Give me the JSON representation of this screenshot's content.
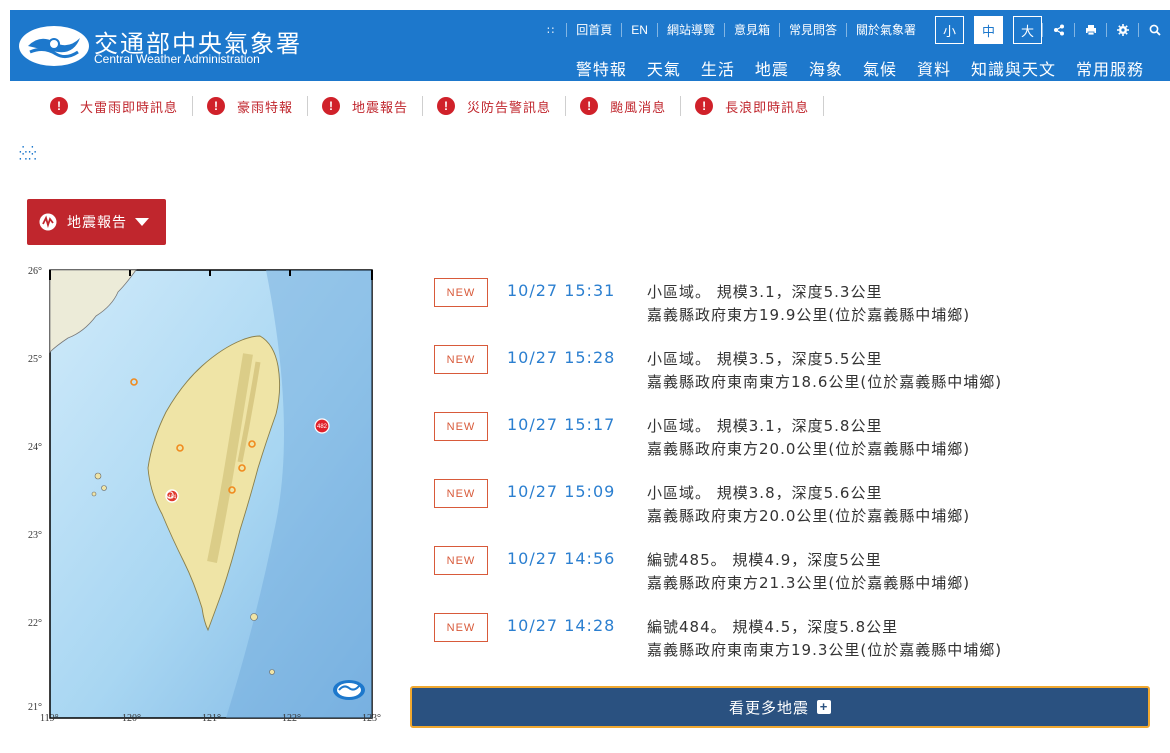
{
  "header": {
    "brand_zh": "交通部中央氣象署",
    "brand_en": "Central Weather Administration",
    "utility_links": [
      "回首頁",
      "EN",
      "網站導覽",
      "意見箱",
      "常見問答",
      "關於氣象署"
    ],
    "font_sizes": [
      "小",
      "中",
      "大"
    ],
    "active_font_size": "中",
    "tool_icons": [
      "share-icon",
      "print-icon",
      "gear-icon",
      "search-icon"
    ],
    "main_nav": [
      "警特報",
      "天氣",
      "生活",
      "地震",
      "海象",
      "氣候",
      "資料",
      "知識與天文",
      "常用服務"
    ]
  },
  "alerts": [
    {
      "label": "大雷雨即時訊息",
      "icon": "exclamation-icon"
    },
    {
      "label": "豪雨特報",
      "icon": "exclamation-icon"
    },
    {
      "label": "地震報告",
      "icon": "exclamation-icon"
    },
    {
      "label": "災防告警訊息",
      "icon": "exclamation-icon"
    },
    {
      "label": "颱風消息",
      "icon": "exclamation-icon"
    },
    {
      "label": "長浪即時訊息",
      "icon": "exclamation-icon"
    }
  ],
  "dropdown": {
    "label": "地震報告"
  },
  "map": {
    "lat_labels": [
      "26°",
      "25°",
      "24°",
      "23°",
      "22°",
      "21°"
    ],
    "lon_labels": [
      "119°",
      "120°",
      "121°",
      "122°",
      "123°"
    ],
    "marker_labels": [
      "484",
      "482"
    ]
  },
  "events": [
    {
      "badge": "NEW",
      "time": "10/27 15:31",
      "line1": "小區域。 規模3.1，深度5.3公里",
      "line2": "嘉義縣政府東方19.9公里(位於嘉義縣中埔鄉)"
    },
    {
      "badge": "NEW",
      "time": "10/27 15:28",
      "line1": "小區域。 規模3.5，深度5.5公里",
      "line2": "嘉義縣政府東南東方18.6公里(位於嘉義縣中埔鄉)"
    },
    {
      "badge": "NEW",
      "time": "10/27 15:17",
      "line1": "小區域。 規模3.1，深度5.8公里",
      "line2": "嘉義縣政府東方20.0公里(位於嘉義縣中埔鄉)"
    },
    {
      "badge": "NEW",
      "time": "10/27 15:09",
      "line1": "小區域。 規模3.8，深度5.6公里",
      "line2": "嘉義縣政府東方20.0公里(位於嘉義縣中埔鄉)"
    },
    {
      "badge": "NEW",
      "time": "10/27 14:56",
      "line1": "編號485。 規模4.9，深度5公里",
      "line2": "嘉義縣政府東方21.3公里(位於嘉義縣中埔鄉)"
    },
    {
      "badge": "NEW",
      "time": "10/27 14:28",
      "line1": "編號484。 規模4.5，深度5.8公里",
      "line2": "嘉義縣政府東南東方19.3公里(位於嘉義縣中埔鄉)"
    }
  ],
  "more_button": {
    "label": "看更多地震"
  },
  "colors": {
    "header_blue": "#1d78cc",
    "alert_red": "#c0262d",
    "link_blue": "#2b7fd0",
    "button_navy": "#2a5180",
    "focus_orange": "#f0a830"
  }
}
